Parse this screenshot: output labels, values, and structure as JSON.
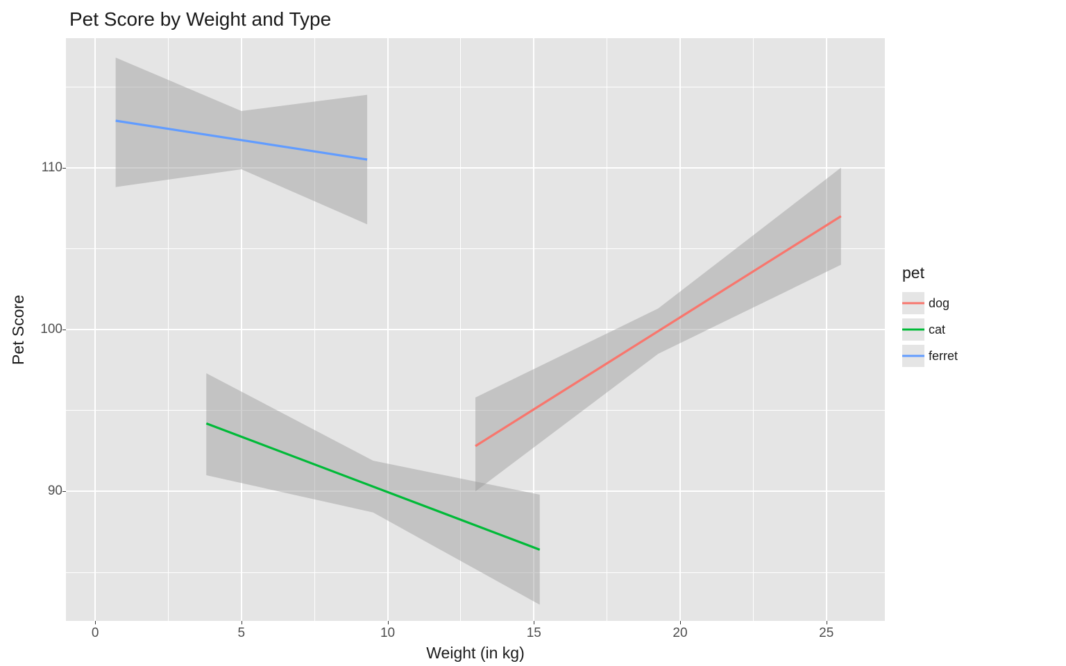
{
  "chart_data": {
    "type": "line",
    "title": "Pet Score by Weight and Type",
    "xlabel": "Weight (in kg)",
    "ylabel": "Pet Score",
    "legend_title": "pet",
    "xlim": [
      -1,
      27
    ],
    "ylim": [
      82,
      118
    ],
    "x_ticks": [
      0,
      5,
      10,
      15,
      20,
      25
    ],
    "y_ticks": [
      90,
      100,
      110
    ],
    "series": [
      {
        "name": "dog",
        "color": "#f8766d",
        "x": [
          13,
          25.5
        ],
        "y": [
          92.8,
          107.0
        ],
        "ribbon_lower": [
          90.0,
          104.0
        ],
        "ribbon_upper": [
          95.8,
          110.0
        ],
        "ribbon_mid_half_width": 1.4
      },
      {
        "name": "cat",
        "color": "#00ba38",
        "x": [
          3.8,
          15.2
        ],
        "y": [
          94.2,
          86.4
        ],
        "ribbon_lower": [
          91.0,
          83.0
        ],
        "ribbon_upper": [
          97.3,
          89.8
        ],
        "ribbon_mid_half_width": 1.6
      },
      {
        "name": "ferret",
        "color": "#619cff",
        "x": [
          0.7,
          9.3
        ],
        "y": [
          112.9,
          110.5
        ],
        "ribbon_lower": [
          108.8,
          106.5
        ],
        "ribbon_upper": [
          116.8,
          114.5
        ],
        "ribbon_mid_half_width": 1.8
      }
    ]
  }
}
